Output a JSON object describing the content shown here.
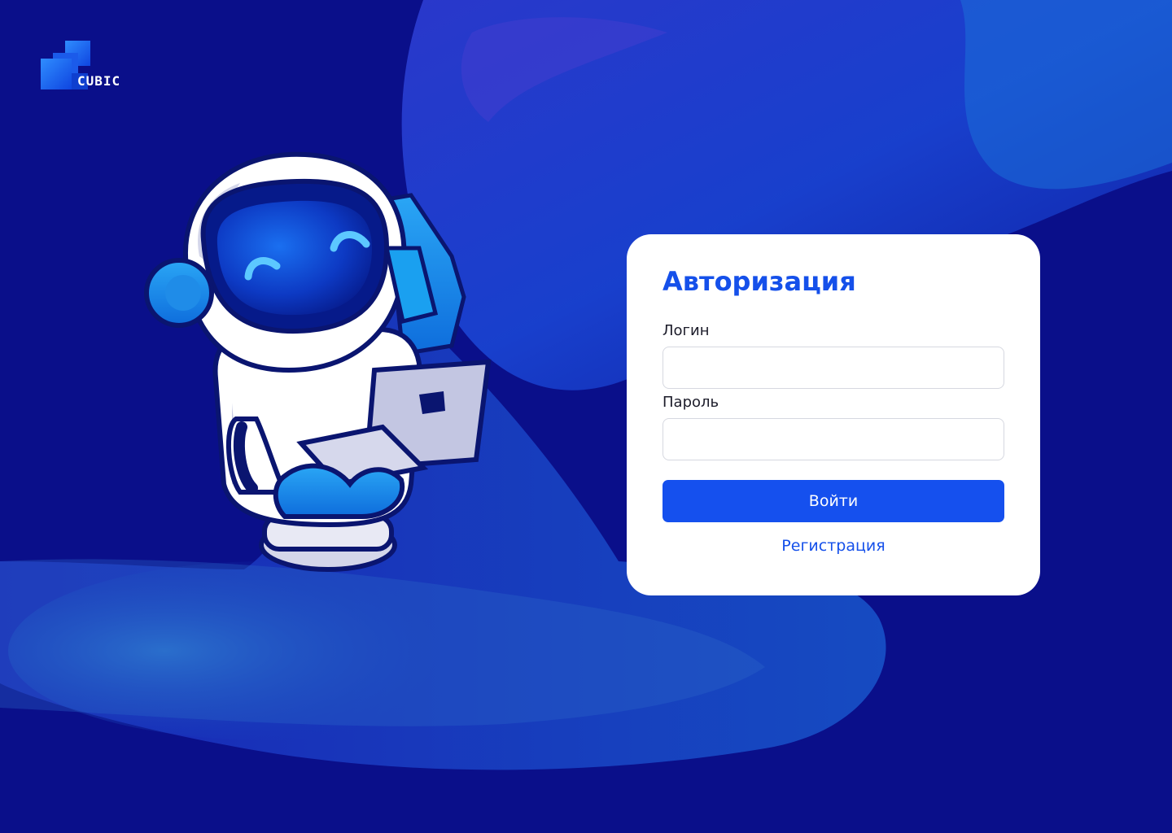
{
  "brand": {
    "name": "CUBIC",
    "icon": "cubic-logo-icon"
  },
  "illustration": {
    "icon": "robot-astronaut-with-laptop-illustration"
  },
  "auth": {
    "title": "Авторизация",
    "login_label": "Логин",
    "login_value": "",
    "password_label": "Пароль",
    "password_value": "",
    "submit_label": "Войти",
    "register_link": "Регистрация"
  },
  "colors": {
    "background": "#0a0f8a",
    "accent": "#1550ee",
    "card": "#ffffff",
    "label_text": "#1c1c2a"
  }
}
